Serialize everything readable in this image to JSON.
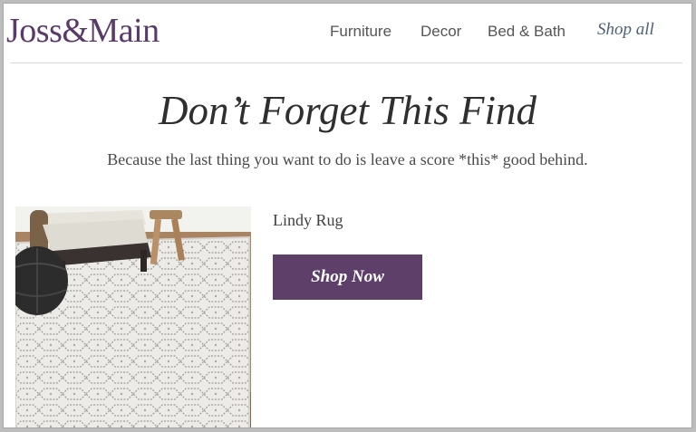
{
  "brand": {
    "logo_text": "Joss&Main",
    "logo_color": "#5a3a6a"
  },
  "nav": {
    "items": [
      {
        "label": "Furniture"
      },
      {
        "label": "Decor"
      },
      {
        "label": "Bed & Bath"
      },
      {
        "label": "Shop all"
      }
    ]
  },
  "hero": {
    "headline": "Don’t Forget This Find",
    "subhead": "Because the last thing you want to do is leave a score *this* good behind."
  },
  "product": {
    "name": "Lindy Rug",
    "image_icon": "rug-product-photo",
    "cta_label": "Shop Now",
    "cta_color": "#5e3f6a"
  }
}
